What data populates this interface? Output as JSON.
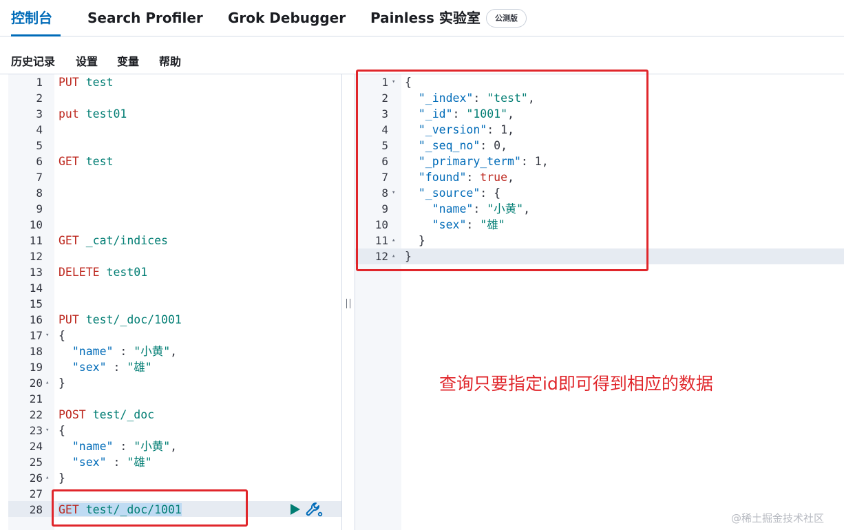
{
  "tabs": [
    {
      "label": "控制台"
    },
    {
      "label": "Search Profiler"
    },
    {
      "label": "Grok Debugger"
    },
    {
      "label": "Painless 实验室"
    }
  ],
  "badge": "公测版",
  "menu": [
    "历史记录",
    "设置",
    "变量",
    "帮助"
  ],
  "left_editor": {
    "lines": [
      {
        "n": "1",
        "tokens": [
          [
            "kw-method",
            "PUT"
          ],
          [
            "punc",
            " "
          ],
          [
            "kw-path",
            "test"
          ]
        ]
      },
      {
        "n": "2",
        "tokens": []
      },
      {
        "n": "3",
        "tokens": [
          [
            "kw-method",
            "put"
          ],
          [
            "punc",
            " "
          ],
          [
            "kw-path",
            "test01"
          ]
        ]
      },
      {
        "n": "4",
        "tokens": []
      },
      {
        "n": "5",
        "tokens": []
      },
      {
        "n": "6",
        "tokens": [
          [
            "kw-method",
            "GET"
          ],
          [
            "punc",
            " "
          ],
          [
            "kw-path",
            "test"
          ]
        ]
      },
      {
        "n": "7",
        "tokens": []
      },
      {
        "n": "8",
        "tokens": []
      },
      {
        "n": "9",
        "tokens": []
      },
      {
        "n": "10",
        "tokens": []
      },
      {
        "n": "11",
        "tokens": [
          [
            "kw-method",
            "GET"
          ],
          [
            "punc",
            " "
          ],
          [
            "kw-path",
            "_cat/indices"
          ]
        ]
      },
      {
        "n": "12",
        "tokens": []
      },
      {
        "n": "13",
        "tokens": [
          [
            "kw-method",
            "DELETE"
          ],
          [
            "punc",
            " "
          ],
          [
            "kw-path",
            "test01"
          ]
        ]
      },
      {
        "n": "14",
        "tokens": []
      },
      {
        "n": "15",
        "tokens": []
      },
      {
        "n": "16",
        "tokens": [
          [
            "kw-method",
            "PUT"
          ],
          [
            "punc",
            " "
          ],
          [
            "kw-path",
            "test/_doc/1001"
          ]
        ]
      },
      {
        "n": "17",
        "fold": "▾",
        "tokens": [
          [
            "punc",
            "{"
          ]
        ]
      },
      {
        "n": "18",
        "tokens": [
          [
            "punc",
            "  "
          ],
          [
            "key",
            "\"name\""
          ],
          [
            "punc",
            " : "
          ],
          [
            "str",
            "\"小黄\""
          ],
          [
            "punc",
            ","
          ]
        ]
      },
      {
        "n": "19",
        "tokens": [
          [
            "punc",
            "  "
          ],
          [
            "key",
            "\"sex\""
          ],
          [
            "punc",
            " : "
          ],
          [
            "str",
            "\"雄\""
          ]
        ]
      },
      {
        "n": "20",
        "fold": "▴",
        "tokens": [
          [
            "punc",
            "}"
          ]
        ]
      },
      {
        "n": "21",
        "tokens": []
      },
      {
        "n": "22",
        "tokens": [
          [
            "kw-method",
            "POST"
          ],
          [
            "punc",
            " "
          ],
          [
            "kw-path",
            "test/_doc"
          ]
        ]
      },
      {
        "n": "23",
        "fold": "▾",
        "tokens": [
          [
            "punc",
            "{"
          ]
        ]
      },
      {
        "n": "24",
        "tokens": [
          [
            "punc",
            "  "
          ],
          [
            "key",
            "\"name\""
          ],
          [
            "punc",
            " : "
          ],
          [
            "str",
            "\"小黄\""
          ],
          [
            "punc",
            ","
          ]
        ]
      },
      {
        "n": "25",
        "tokens": [
          [
            "punc",
            "  "
          ],
          [
            "key",
            "\"sex\""
          ],
          [
            "punc",
            " : "
          ],
          [
            "str",
            "\"雄\""
          ]
        ]
      },
      {
        "n": "26",
        "fold": "▴",
        "tokens": [
          [
            "punc",
            "}"
          ]
        ]
      },
      {
        "n": "27",
        "tokens": []
      },
      {
        "n": "28",
        "tokens": [
          [
            "kw-method sel",
            "GET"
          ],
          [
            "punc sel",
            " "
          ],
          [
            "kw-path sel",
            "test/_doc/1001"
          ]
        ]
      }
    ]
  },
  "right_editor": {
    "lines": [
      {
        "n": "1",
        "fold": "▾",
        "tokens": [
          [
            "punc",
            "{"
          ]
        ]
      },
      {
        "n": "2",
        "tokens": [
          [
            "punc",
            "  "
          ],
          [
            "key",
            "\"_index\""
          ],
          [
            "punc",
            ": "
          ],
          [
            "str",
            "\"test\""
          ],
          [
            "punc",
            ","
          ]
        ]
      },
      {
        "n": "3",
        "tokens": [
          [
            "punc",
            "  "
          ],
          [
            "key",
            "\"_id\""
          ],
          [
            "punc",
            ": "
          ],
          [
            "str",
            "\"1001\""
          ],
          [
            "punc",
            ","
          ]
        ]
      },
      {
        "n": "4",
        "tokens": [
          [
            "punc",
            "  "
          ],
          [
            "key",
            "\"_version\""
          ],
          [
            "punc",
            ": 1,"
          ]
        ]
      },
      {
        "n": "5",
        "tokens": [
          [
            "punc",
            "  "
          ],
          [
            "key",
            "\"_seq_no\""
          ],
          [
            "punc",
            ": 0,"
          ]
        ]
      },
      {
        "n": "6",
        "tokens": [
          [
            "punc",
            "  "
          ],
          [
            "key",
            "\"_primary_term\""
          ],
          [
            "punc",
            ": 1,"
          ]
        ]
      },
      {
        "n": "7",
        "tokens": [
          [
            "punc",
            "  "
          ],
          [
            "key",
            "\"found\""
          ],
          [
            "punc",
            ": "
          ],
          [
            "bool",
            "true"
          ],
          [
            "punc",
            ","
          ]
        ]
      },
      {
        "n": "8",
        "fold": "▾",
        "tokens": [
          [
            "punc",
            "  "
          ],
          [
            "key",
            "\"_source\""
          ],
          [
            "punc",
            ": {"
          ]
        ]
      },
      {
        "n": "9",
        "tokens": [
          [
            "punc",
            "    "
          ],
          [
            "key",
            "\"name\""
          ],
          [
            "punc",
            ": "
          ],
          [
            "str",
            "\"小黄\""
          ],
          [
            "punc",
            ","
          ]
        ]
      },
      {
        "n": "10",
        "tokens": [
          [
            "punc",
            "    "
          ],
          [
            "key",
            "\"sex\""
          ],
          [
            "punc",
            ": "
          ],
          [
            "str",
            "\"雄\""
          ]
        ]
      },
      {
        "n": "11",
        "fold": "▴",
        "tokens": [
          [
            "punc",
            "  }"
          ]
        ]
      },
      {
        "n": "12",
        "fold": "▴",
        "tokens": [
          [
            "punc",
            "}"
          ]
        ]
      }
    ]
  },
  "annotation": "查询只要指定id即可得到相应的数据",
  "watermark": "@稀土掘金技术社区",
  "colors": {
    "accent": "#006bb8",
    "method": "#bd271e",
    "string": "#017d73",
    "annotation": "#e0262b"
  },
  "icons": [
    "play-icon",
    "wrench-icon"
  ]
}
